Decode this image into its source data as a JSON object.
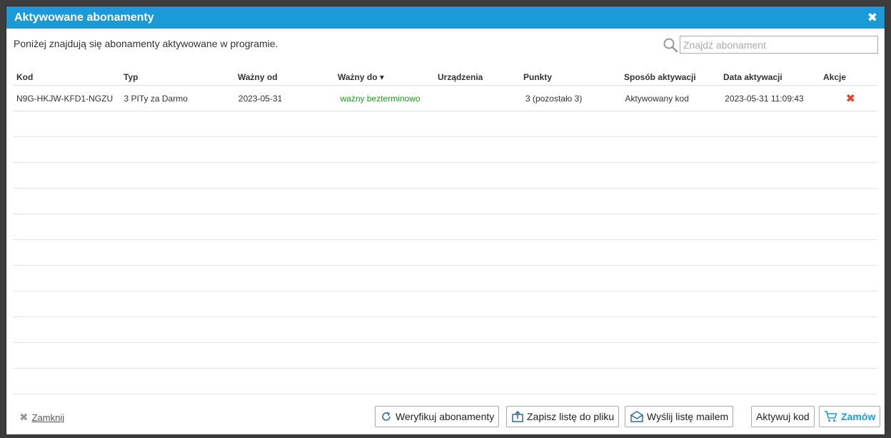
{
  "dialog": {
    "title": "Aktywowane abonamenty",
    "close_icon": "close-icon",
    "intro": "Poniżej znajdują się abonamenty aktywowane w programie.",
    "search": {
      "placeholder": "Znajdź abonament",
      "value": ""
    }
  },
  "table": {
    "headers": [
      "Kod",
      "Typ",
      "Ważny od",
      "Ważny do ▾",
      "Urządzenia",
      "Punkty",
      "Sposób aktywacji",
      "Data aktywacji",
      "Akcje"
    ],
    "rows": [
      {
        "kod": "N9G-HKJW-KFD1-NGZU",
        "typ": "3 PITy za Darmo",
        "wazny_od": "2023-05-31",
        "wazny_do": "ważny bezterminowo",
        "urzadzenia": "",
        "punkty": "3 (pozostało 3)",
        "sposob": "Aktywowany kod",
        "data_aktywacji": "2023-05-31 11:09:43",
        "akcja": "✖"
      }
    ]
  },
  "footer": {
    "close_label": "Zamknij",
    "verify_label": "Weryfikuj abonamenty",
    "save_label": "Zapisz listę do pliku",
    "mail_label": "Wyślij listę mailem",
    "activate_label": "Aktywuj kod",
    "order_label": "Zamów"
  },
  "colors": {
    "titlebar": "#1a9ad6",
    "valid": "#1e9a1e",
    "delete": "#e0442a"
  }
}
